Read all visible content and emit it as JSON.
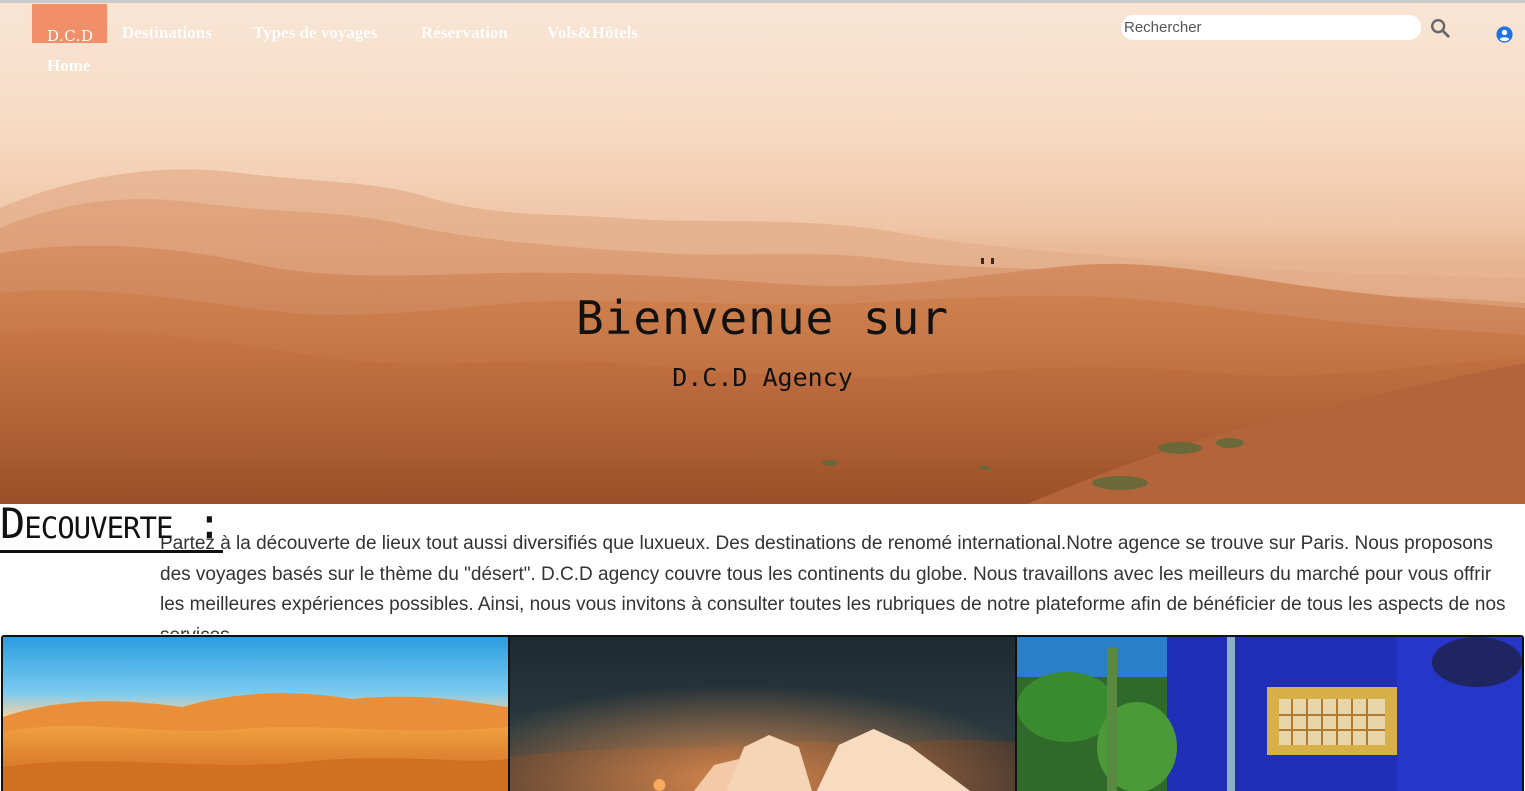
{
  "brand": {
    "logo": "D.C.D"
  },
  "nav": {
    "items": [
      "Destinations",
      "Types de voyages",
      "Réservation",
      "Vols&Hôtels"
    ],
    "home": "Home"
  },
  "search": {
    "placeholder": "Rechercher",
    "value": ""
  },
  "icons": {
    "search": "search-icon",
    "user": "user-circle-icon"
  },
  "hero": {
    "title": "Bienvenue sur",
    "subtitle": "D.C.D Agency"
  },
  "decouverte": {
    "heading": "Decouverte :",
    "text": "Partez à la découverte de lieux tout aussi diversifiés que luxueux. Des destinations de renomé international.Notre agence se trouve sur Paris. Nous proposons des voyages basés sur le thème du \"désert\". D.C.D agency couvre tous les continents du globe. Nous travaillons avec les meilleurs du marché pour vous offrir les meilleures expériences possibles. Ainsi, nous vous invitons à consulter toutes les rubriques de notre plateforme afin de bénéficier de tous les aspects de nos services."
  },
  "gallery": [
    "desert-dunes-image",
    "desert-camp-tents-image",
    "majorelle-garden-image"
  ],
  "colors": {
    "logo_bg": "#f08f6a",
    "user_icon": "#1a73e8"
  }
}
